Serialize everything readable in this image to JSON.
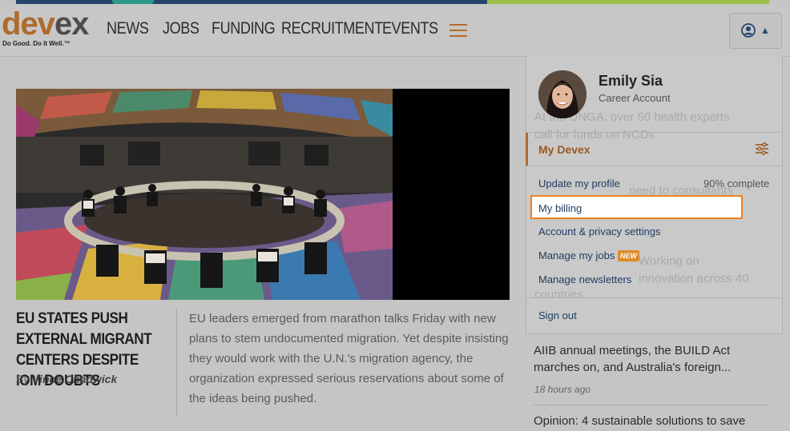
{
  "header": {
    "logo": {
      "word_a": "dev",
      "word_b": "ex",
      "tagline": "Do Good. Do It Well.™"
    },
    "nav": [
      "NEWS",
      "JOBS",
      "FUNDING",
      "RECRUITMENT",
      "EVENTS"
    ]
  },
  "article": {
    "headline": "EU STATES PUSH EXTERNAL MIGRANT CENTERS DESPITE IOM DOUBTS",
    "by_prefix": "By",
    "author": "Vince Chadwick",
    "summary": "EU leaders emerged from marathon talks Friday with new plans to stem undocumented migration. Yet despite insisting they would work with the U.N.'s migration agency, the organization expressed serious reservations about some of the ideas being pushed."
  },
  "side_news": [
    {
      "title": "AIIB annual meetings, the BUILD Act marches on, and Australia's foreign...",
      "time": "18 hours ago"
    },
    {
      "title": "Opinion: 4 sustainable solutions to save"
    }
  ],
  "background_ghost": [
    "At the UNGA: over 50 health experts",
    "call for funds on NCDs",
    "need to consultants",
    "Working on",
    "innovation across 40",
    "countries"
  ],
  "account_menu": {
    "user_name": "Emily Sia",
    "account_type": "Career Account",
    "section_title": "My Devex",
    "items": {
      "update_profile": "Update my profile",
      "profile_complete": "90% complete",
      "billing": "My billing",
      "privacy": "Account & privacy settings",
      "jobs": "Manage my jobs",
      "jobs_badge": "NEW",
      "newsletters": "Manage newsletters",
      "sign_out": "Sign out"
    }
  },
  "colors": {
    "brand_orange": "#b06a2a",
    "highlight": "#f0801e",
    "link": "#1f3d63"
  }
}
